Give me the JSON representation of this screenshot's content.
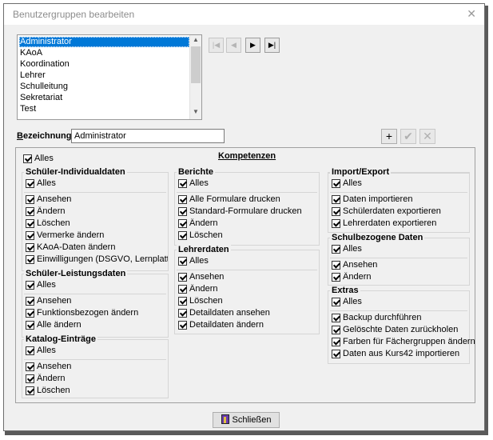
{
  "window": {
    "title": "Benutzergruppen bearbeiten",
    "close_glyph": "✕"
  },
  "groups_list": {
    "items": [
      "Administrator",
      "KAoA",
      "Koordination",
      "Lehrer",
      "Schulleitung",
      "Sekretariat",
      "Test"
    ],
    "selected": "Administrator"
  },
  "nav": {
    "first": "|◀",
    "prev": "◀",
    "next": "▶",
    "last": "▶|"
  },
  "bezeichnung": {
    "label": "Bezeichnung",
    "value": "Administrator"
  },
  "toolbar": {
    "add": "+",
    "save": "✔",
    "delete": "✕"
  },
  "kompetenzen": {
    "title": "Kompetenzen",
    "all_label": "Alles",
    "groups": {
      "schueler_individual": {
        "title": "Schüler-Individualdaten",
        "all": "Alles",
        "items": [
          "Ansehen",
          "Ändern",
          "Löschen",
          "Vermerke ändern",
          "KAoA-Daten ändern",
          "Einwilligungen (DSGVO, Lernplattformen)"
        ]
      },
      "schueler_leistung": {
        "title": "Schüler-Leistungsdaten",
        "all": "Alles",
        "items": [
          "Ansehen",
          "Funktionsbezogen ändern",
          "Alle ändern"
        ]
      },
      "katalog": {
        "title": "Katalog-Einträge",
        "all": "Alles",
        "items": [
          "Ansehen",
          "Ändern",
          "Löschen"
        ]
      },
      "berichte": {
        "title": "Berichte",
        "all": "Alles",
        "items": [
          "Alle Formulare drucken",
          "Standard-Formulare drucken",
          "Ändern",
          "Löschen"
        ]
      },
      "lehrerdaten": {
        "title": "Lehrerdaten",
        "all": "Alles",
        "items": [
          "Ansehen",
          "Ändern",
          "Löschen",
          "Detaildaten ansehen",
          "Detaildaten ändern"
        ]
      },
      "import_export": {
        "title": "Import/Export",
        "all": "Alles",
        "items": [
          "Daten importieren",
          "Schülerdaten exportieren",
          "Lehrerdaten exportieren"
        ]
      },
      "schulbezogen": {
        "title": "Schulbezogene Daten",
        "all": "Alles",
        "items": [
          "Ansehen",
          "Ändern"
        ]
      },
      "extras": {
        "title": "Extras",
        "all": "Alles",
        "items": [
          "Backup durchführen",
          "Gelöschte Daten zurückholen",
          "Farben für Fächergruppen ändern",
          "Daten aus Kurs42 importieren"
        ]
      }
    }
  },
  "footer": {
    "close_label": "Schließen"
  },
  "colors": {
    "selection": "#0078d7",
    "background": "#f0f0f0"
  }
}
